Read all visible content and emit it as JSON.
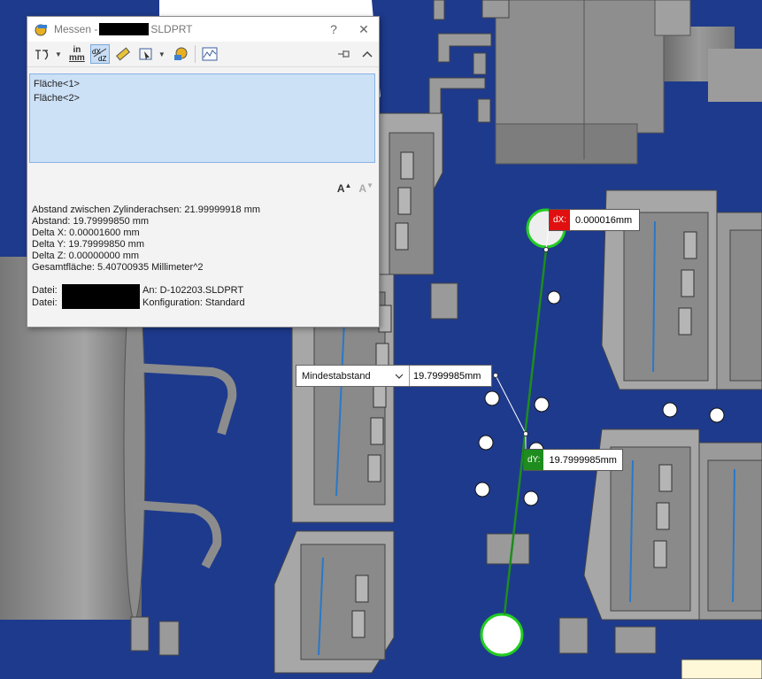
{
  "dialog": {
    "title_prefix": "Messen -",
    "title_suffix": "SLDPRT",
    "help_label": "?",
    "close_label": "✕",
    "toolbar": {
      "units_label_top": "in",
      "units_label_bottom": "mm"
    },
    "selections": [
      "Fläche<1>",
      "Fläche<2>"
    ],
    "results": [
      "Abstand zwischen Zylinderachsen:  21.99999918 mm",
      "Abstand: 19.79999850 mm",
      "Delta X: 0.00001600 mm",
      "Delta Y: 19.79999850 mm",
      "Delta Z: 0.00000000 mm",
      "Gesamtfläche: 5.40700935 Millimeter^2"
    ],
    "files": [
      {
        "label": "Datei:",
        "info": "An: D-102203.SLDPRT"
      },
      {
        "label": "Datei:",
        "info": "Konfiguration: Standard"
      }
    ]
  },
  "callouts": {
    "dx": {
      "tag": "dX:",
      "value": "0.000016mm"
    },
    "dy": {
      "tag": "dY:",
      "value": "19.7999985mm"
    },
    "min": {
      "option": "Mindestabstand",
      "value": "19.7999985mm"
    }
  },
  "colors": {
    "board": "#1e3a8c",
    "component_gray": "#8e8e8e",
    "measure_line": "#1e8c1e",
    "dx_tag": "#e01010",
    "dy_tag": "#1e8c1e",
    "selection_bg": "#cce0f6"
  }
}
